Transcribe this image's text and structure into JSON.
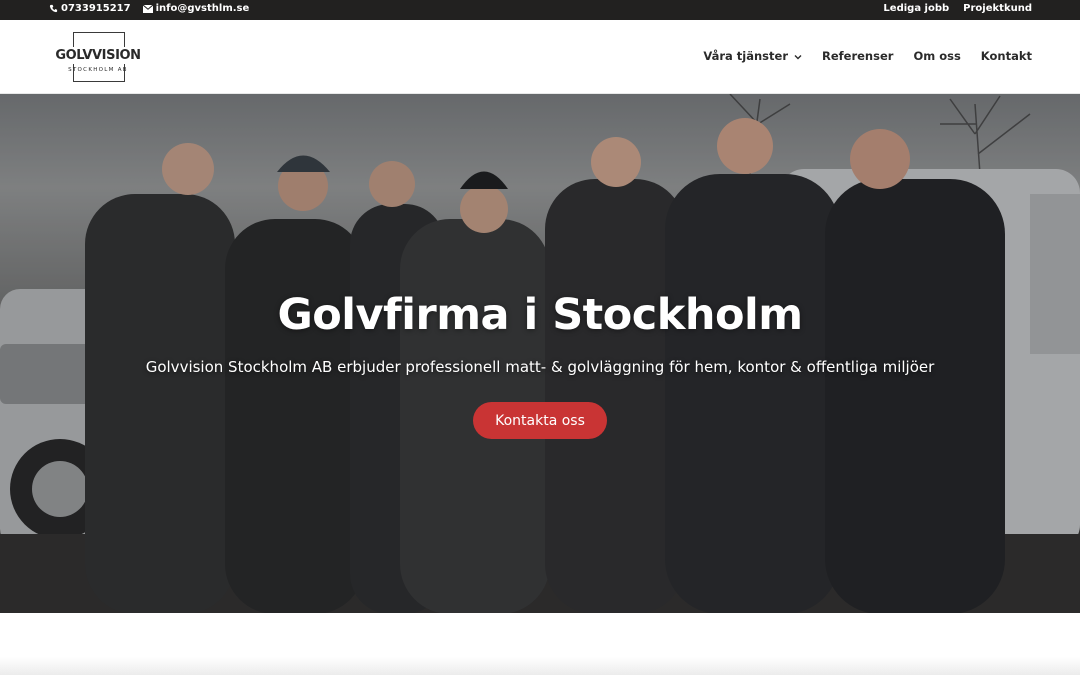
{
  "topbar": {
    "phone": "0733915217",
    "email": "info@gvsthlm.se",
    "links": [
      "Lediga jobb",
      "Projektkund"
    ],
    "phone_icon": "phone-icon",
    "email_icon": "envelope-icon"
  },
  "header": {
    "logo_name": "GOLVVISION",
    "logo_sub": "STOCKHOLM AB",
    "nav": {
      "services": "Våra tjänster",
      "references": "Referenser",
      "about": "Om oss",
      "contact": "Kontakt"
    }
  },
  "hero": {
    "title": "Golvfirma i Stockholm",
    "lead": "Golvvision Stockholm AB erbjuder professionell matt- & golvläggning för hem, kontor & offentliga miljöer",
    "cta": "Kontakta oss"
  },
  "colors": {
    "topbar_bg": "#222120",
    "accent": "#c93434",
    "text": "#2b2b2b"
  }
}
